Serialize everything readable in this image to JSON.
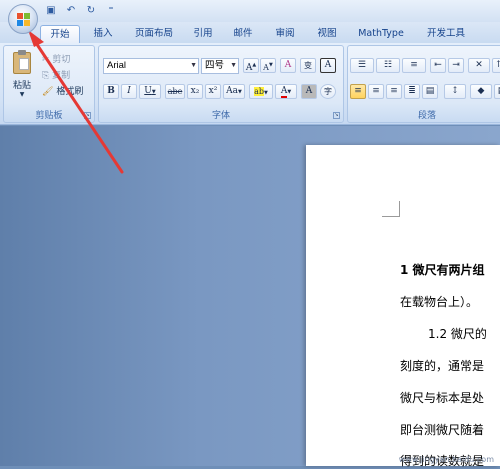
{
  "title_bar": {
    "office_button_icon": "office-logo-icon",
    "quick_access": [
      {
        "name": "save-icon",
        "glyph": "▣"
      },
      {
        "name": "undo-icon",
        "glyph": "↶"
      },
      {
        "name": "redo-icon",
        "glyph": "↻"
      },
      {
        "name": "customize-icon",
        "glyph": "⁼"
      }
    ]
  },
  "tabs": [
    "开始",
    "插入",
    "页面布局",
    "引用",
    "邮件",
    "审阅",
    "视图",
    "MathType",
    "开发工具"
  ],
  "ribbon": {
    "clipboard": {
      "label": "剪贴板",
      "paste": "粘贴",
      "cut": "剪切",
      "copy": "复制",
      "format_painter": "格式刷"
    },
    "font": {
      "label": "字体",
      "font_name": "Arial",
      "font_size": "四号",
      "grow": "A",
      "shrink": "A",
      "clear": "A",
      "phonetic": "变",
      "border_char": "A",
      "bold": "B",
      "italic": "I",
      "underline": "U",
      "strike": "abe",
      "subscript": "x₂",
      "superscript": "x²",
      "change_case": "Aa",
      "highlight": "ab",
      "font_color": "A",
      "shade": "A",
      "enclose": "字"
    },
    "paragraph": {
      "label": "段落"
    }
  },
  "document": {
    "lines": [
      "1 微尺有两片组",
      "在载物台上）。",
      "1.2 微尺的",
      "刻度的，通常是",
      "微尺与标本是处",
      "即台测微尺随着",
      "得到的读数就是"
    ]
  },
  "watermark": "www.jingyan.baidu.com",
  "colors": {
    "accent_arrow": "#e53935",
    "highlight": "#ffd35e"
  }
}
